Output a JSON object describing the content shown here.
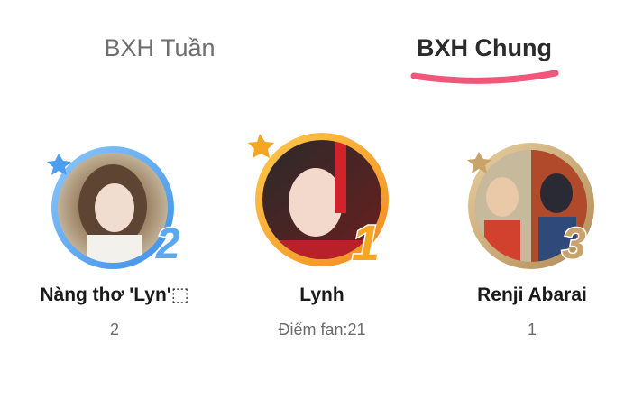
{
  "tabs": {
    "weekly_label": "BXH Tuần",
    "overall_label": "BXH Chung",
    "active": "overall",
    "underline_color": "#f0577a"
  },
  "ranking": [
    {
      "rank": "2",
      "name": "Nàng thơ 'Lyn'⬚",
      "score": "2",
      "ring_color": "#5aa8f0"
    },
    {
      "rank": "1",
      "name": "Lynh",
      "score": "Điểm fan:21",
      "ring_color": "#f5a623"
    },
    {
      "rank": "3",
      "name": "Renji Abarai",
      "score": "1",
      "ring_color": "#c9a46a"
    }
  ]
}
